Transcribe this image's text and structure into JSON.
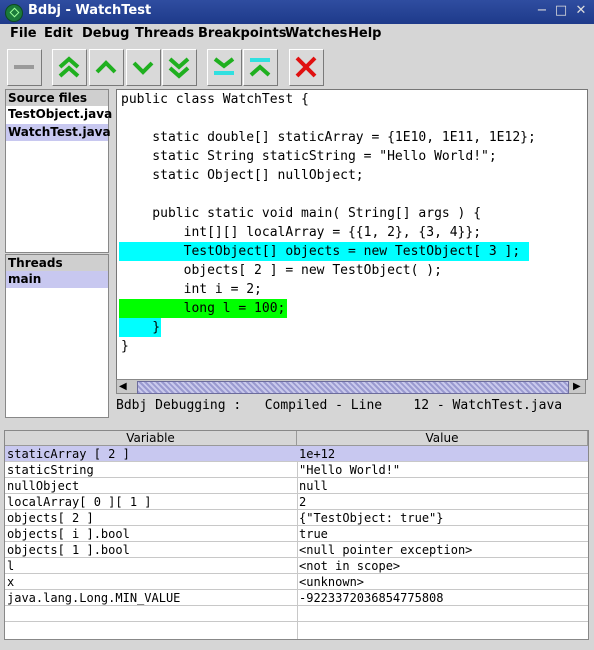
{
  "window": {
    "title": "Bdbj - WatchTest",
    "controls": [
      "−",
      "□",
      "✕"
    ]
  },
  "menu": [
    "File",
    "Edit",
    "Debug",
    "Threads",
    "Breakpoints",
    "Watches",
    "Help"
  ],
  "toolbar": [
    "stop-icon",
    "step-out-icon",
    "step-over-up-icon",
    "step-over-down-icon",
    "step-into-icon",
    "run-to-line-icon",
    "run-to-cursor-icon",
    "close-debug-icon"
  ],
  "source_files": {
    "header": "Source files",
    "items": [
      "TestObject.java",
      "WatchTest.java"
    ],
    "selected": 1
  },
  "threads": {
    "header": "Threads",
    "items": [
      "main"
    ]
  },
  "code": {
    "lines": [
      "public class WatchTest {",
      "",
      "    static double[] staticArray = {1E10, 1E11, 1E12};",
      "    static String staticString = \"Hello World!\";",
      "    static Object[] nullObject;",
      "",
      "    public static void main( String[] args ) {",
      "        int[][] localArray = {{1, 2}, {3, 4}};",
      "        TestObject[] objects = new TestObject[ 3 ];",
      "        objects[ 2 ] = new TestObject( );",
      "        int i = 2;",
      "        long l = 100;",
      "    }",
      "}"
    ],
    "highlight_cyan": 8,
    "highlight_green": 11,
    "highlight_close": 12
  },
  "status": "Bdbj Debugging :   Compiled - Line    12 - WatchTest.java",
  "watch": {
    "columns": [
      "Variable",
      "Value"
    ],
    "rows": [
      {
        "var": "staticArray [ 2 ]",
        "val": "1e+12"
      },
      {
        "var": "staticString",
        "val": "\"Hello World!\""
      },
      {
        "var": "nullObject",
        "val": "null"
      },
      {
        "var": "localArray[ 0 ][ 1 ]",
        "val": "2"
      },
      {
        "var": "objects[ 2 ]",
        "val": "{\"TestObject: true\"}"
      },
      {
        "var": "objects[ i ].bool",
        "val": "true"
      },
      {
        "var": "objects[ 1 ].bool",
        "val": "<null pointer exception>"
      },
      {
        "var": "l",
        "val": "<not in scope>"
      },
      {
        "var": "x",
        "val": "<unknown>"
      },
      {
        "var": "java.lang.Long.MIN_VALUE",
        "val": "-9223372036854775808"
      },
      {
        "var": "",
        "val": ""
      }
    ],
    "selected": 0
  }
}
